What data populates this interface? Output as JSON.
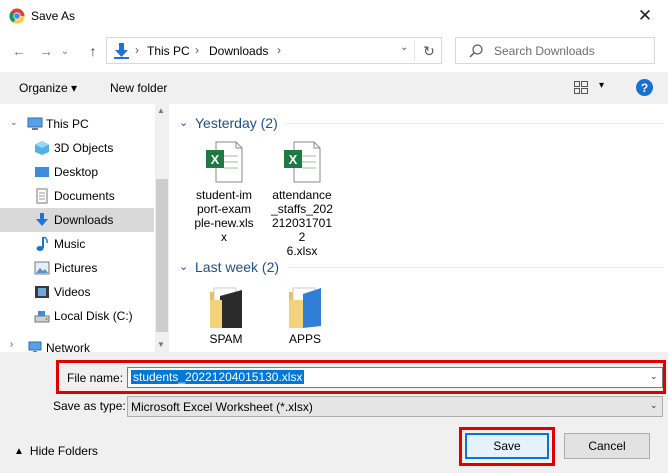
{
  "window": {
    "title": "Save As",
    "close_glyph": "✕"
  },
  "nav": {
    "back_glyph": "←",
    "forward_glyph": "→",
    "recent_glyph": "⌄",
    "up_glyph": "↑",
    "breadcrumbs": [
      "This PC",
      "Downloads"
    ],
    "breadcrumb_sep": "›",
    "refresh_glyph": "↻",
    "search_placeholder": "Search Downloads"
  },
  "toolbar": {
    "organize_label": "Organize ▾",
    "new_folder_label": "New folder",
    "view_dropdown": "▾",
    "help_label": "?"
  },
  "sidebar": {
    "items": [
      {
        "label": "This PC",
        "icon": "pc-icon"
      },
      {
        "label": "3D Objects",
        "icon": "cube-icon"
      },
      {
        "label": "Desktop",
        "icon": "desktop-icon"
      },
      {
        "label": "Documents",
        "icon": "documents-icon"
      },
      {
        "label": "Downloads",
        "icon": "download-icon",
        "selected": true
      },
      {
        "label": "Music",
        "icon": "music-icon"
      },
      {
        "label": "Pictures",
        "icon": "pictures-icon"
      },
      {
        "label": "Videos",
        "icon": "videos-icon"
      },
      {
        "label": "Local Disk (C:)",
        "icon": "disk-icon"
      },
      {
        "label": "Network",
        "icon": "network-icon"
      }
    ]
  },
  "content": {
    "groups": [
      {
        "title": "Yesterday (2)",
        "files": [
          {
            "name": "student-im\nport-exam\nple-new.xls\nx",
            "icon": "excel-file-icon"
          },
          {
            "name": "attendance\n_staffs_202\n2120317012\n6.xlsx",
            "icon": "excel-file-icon"
          }
        ]
      },
      {
        "title": "Last week (2)",
        "files": [
          {
            "name": "SPAM",
            "icon": "folder-icon"
          },
          {
            "name": "APPS",
            "icon": "folder-icon"
          }
        ]
      }
    ]
  },
  "form": {
    "file_name_label": "File name:",
    "file_name_value": "students_20221204015130.xlsx",
    "save_type_label": "Save as type:",
    "save_type_value": "Microsoft Excel Worksheet (*.xlsx)",
    "hide_folders_label": "Hide Folders",
    "save_label": "Save",
    "cancel_label": "Cancel"
  },
  "colors": {
    "highlight_red": "#e00000",
    "selection_blue": "#0078d7",
    "group_blue": "#1e4e8c"
  }
}
